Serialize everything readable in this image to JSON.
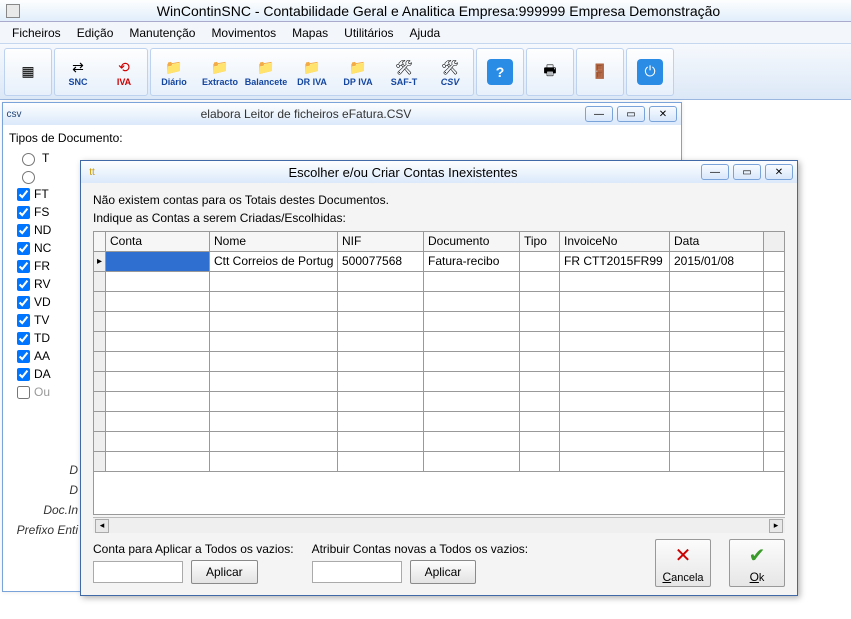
{
  "app": {
    "title": "WinContinSNC - Contabilidade Geral e Analitica Empresa:999999 Empresa Demonstração"
  },
  "menu": [
    "Ficheiros",
    "Edição",
    "Manutenção",
    "Movimentos",
    "Mapas",
    "Utilitários",
    "Ajuda"
  ],
  "toolbar": {
    "snc": "SNC",
    "iva": "IVA",
    "diario": "Diário",
    "extracto": "Extracto",
    "balancete": "Balancete",
    "driva": "DR IVA",
    "dpiva": "DP IVA",
    "saft": "SAF-T",
    "csv": "CSV"
  },
  "child1": {
    "title": "elabora Leitor de ficheiros eFatura.CSV",
    "tiposLabel": "Tipos de Documento:",
    "radio1": "T",
    "checks": [
      "FT",
      "FS",
      "ND",
      "NC",
      "FR",
      "RV",
      "VD",
      "TV",
      "TD",
      "AA",
      "DA"
    ],
    "out": "Ou",
    "labels": {
      "d": "D",
      "di": "D",
      "docin": "Doc.In",
      "prefixo": "Prefixo Enti"
    }
  },
  "dialog": {
    "title": "Escolher e/ou Criar Contas Inexistentes",
    "msg1": "Não existem contas para os Totais destes Documentos.",
    "msg2": "Indique as Contas a serem Criadas/Escolhidas:",
    "headers": {
      "conta": "Conta",
      "nome": "Nome",
      "nif": "NIF",
      "documento": "Documento",
      "tipo": "Tipo",
      "invoice": "InvoiceNo",
      "data": "Data"
    },
    "rows": [
      {
        "conta": "",
        "nome": "Ctt Correios de Portug",
        "nif": "500077568",
        "documento": "Fatura-recibo",
        "tipo": "",
        "invoice": "FR CTT2015FR99",
        "data": "2015/01/08"
      }
    ],
    "apply1Label": "Conta para Aplicar a Todos os vazios:",
    "apply2Label": "Atribuir Contas novas a Todos os vazios:",
    "aplicar": "Aplicar",
    "cancel": "Cancela",
    "ok": "Ok"
  }
}
